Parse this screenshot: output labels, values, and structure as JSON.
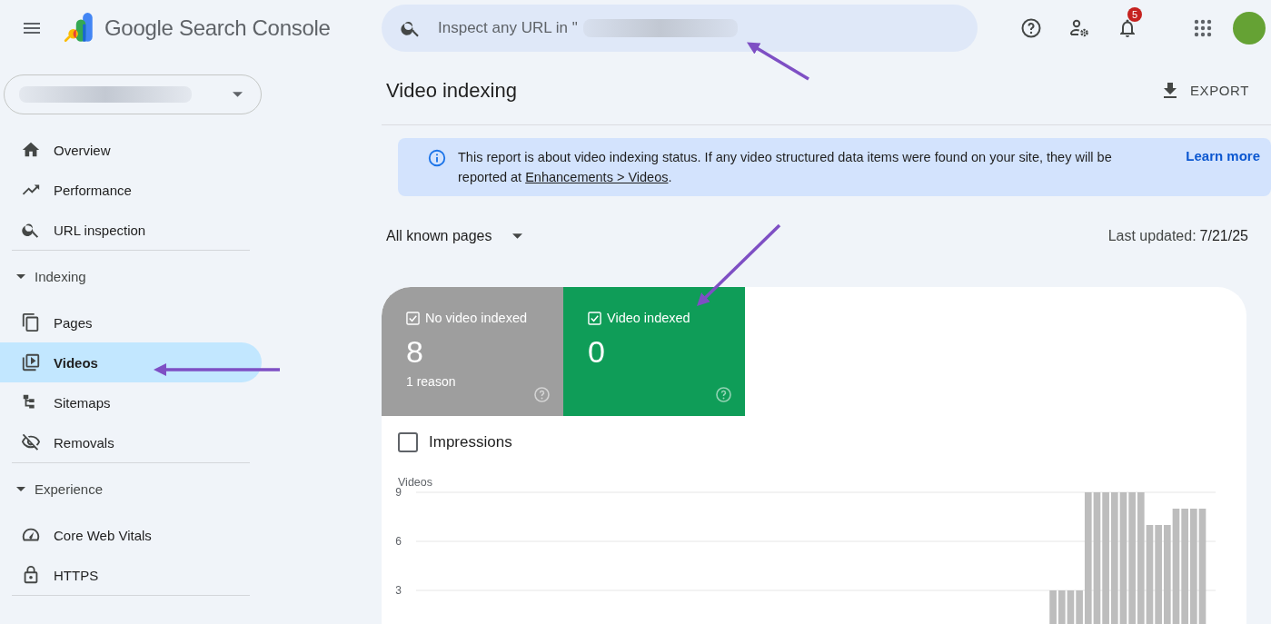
{
  "header": {
    "product_name": "Google Search Console",
    "search": {
      "placeholder": "Inspect any URL in \""
    },
    "notifications_badge": "5"
  },
  "sidebar": {
    "items": [
      {
        "kind": "item",
        "label": "Overview",
        "selected": false
      },
      {
        "kind": "item",
        "label": "Performance",
        "selected": false
      },
      {
        "kind": "item",
        "label": "URL inspection",
        "selected": false
      },
      {
        "kind": "section",
        "label": "Indexing",
        "expanded": true,
        "children": [
          {
            "kind": "item",
            "label": "Pages",
            "selected": false
          },
          {
            "kind": "item",
            "label": "Videos",
            "selected": true
          },
          {
            "kind": "item",
            "label": "Sitemaps",
            "selected": false
          },
          {
            "kind": "item",
            "label": "Removals",
            "selected": false
          }
        ]
      },
      {
        "kind": "section",
        "label": "Experience",
        "expanded": true,
        "children": [
          {
            "kind": "item",
            "label": "Core Web Vitals",
            "selected": false
          },
          {
            "kind": "item",
            "label": "HTTPS",
            "selected": false
          }
        ]
      }
    ]
  },
  "page": {
    "title": "Video indexing",
    "export": "EXPORT"
  },
  "info_banner": {
    "text": "This report is about video indexing status. If any video structured data items were found on your site, they will be reported at ",
    "link": "Enhancements > Videos",
    "text_end": ".",
    "learn_more": "Learn more"
  },
  "filter": {
    "value": "All known pages",
    "last_updated_label": "Last updated:",
    "last_updated_value": "7/21/25"
  },
  "status_cards": [
    {
      "label": "No video indexed",
      "count": "8",
      "sublabel": "1 reason",
      "checked": true,
      "color": "#9e9e9e"
    },
    {
      "label": "Video indexed",
      "count": "0",
      "checked": true,
      "color": "#0f9d58"
    }
  ],
  "impressions": {
    "label": "Impressions",
    "checked": false
  },
  "chart_data": {
    "type": "bar",
    "ylabel": "Videos",
    "ylim": [
      0,
      9
    ],
    "yticks": [
      3,
      6,
      9
    ],
    "values": [
      0,
      0,
      0,
      0,
      0,
      0,
      0,
      0,
      0,
      0,
      0,
      0,
      0,
      0,
      0,
      0,
      0,
      0,
      0,
      0,
      0,
      0,
      0,
      0,
      0,
      0,
      0,
      0,
      0,
      0,
      0,
      0,
      0,
      0,
      0,
      0,
      0,
      0,
      0,
      0,
      0,
      0,
      0,
      0,
      0,
      0,
      0,
      0,
      0,
      0,
      0,
      0,
      0,
      0,
      0,
      0,
      0,
      0,
      0,
      0,
      0,
      0,
      0,
      0,
      0,
      0,
      0,
      0,
      0,
      0,
      0,
      0,
      3,
      3,
      3,
      3,
      9,
      9,
      9,
      9,
      9,
      9,
      9,
      7,
      7,
      7,
      8,
      8,
      8,
      8,
      0
    ]
  }
}
